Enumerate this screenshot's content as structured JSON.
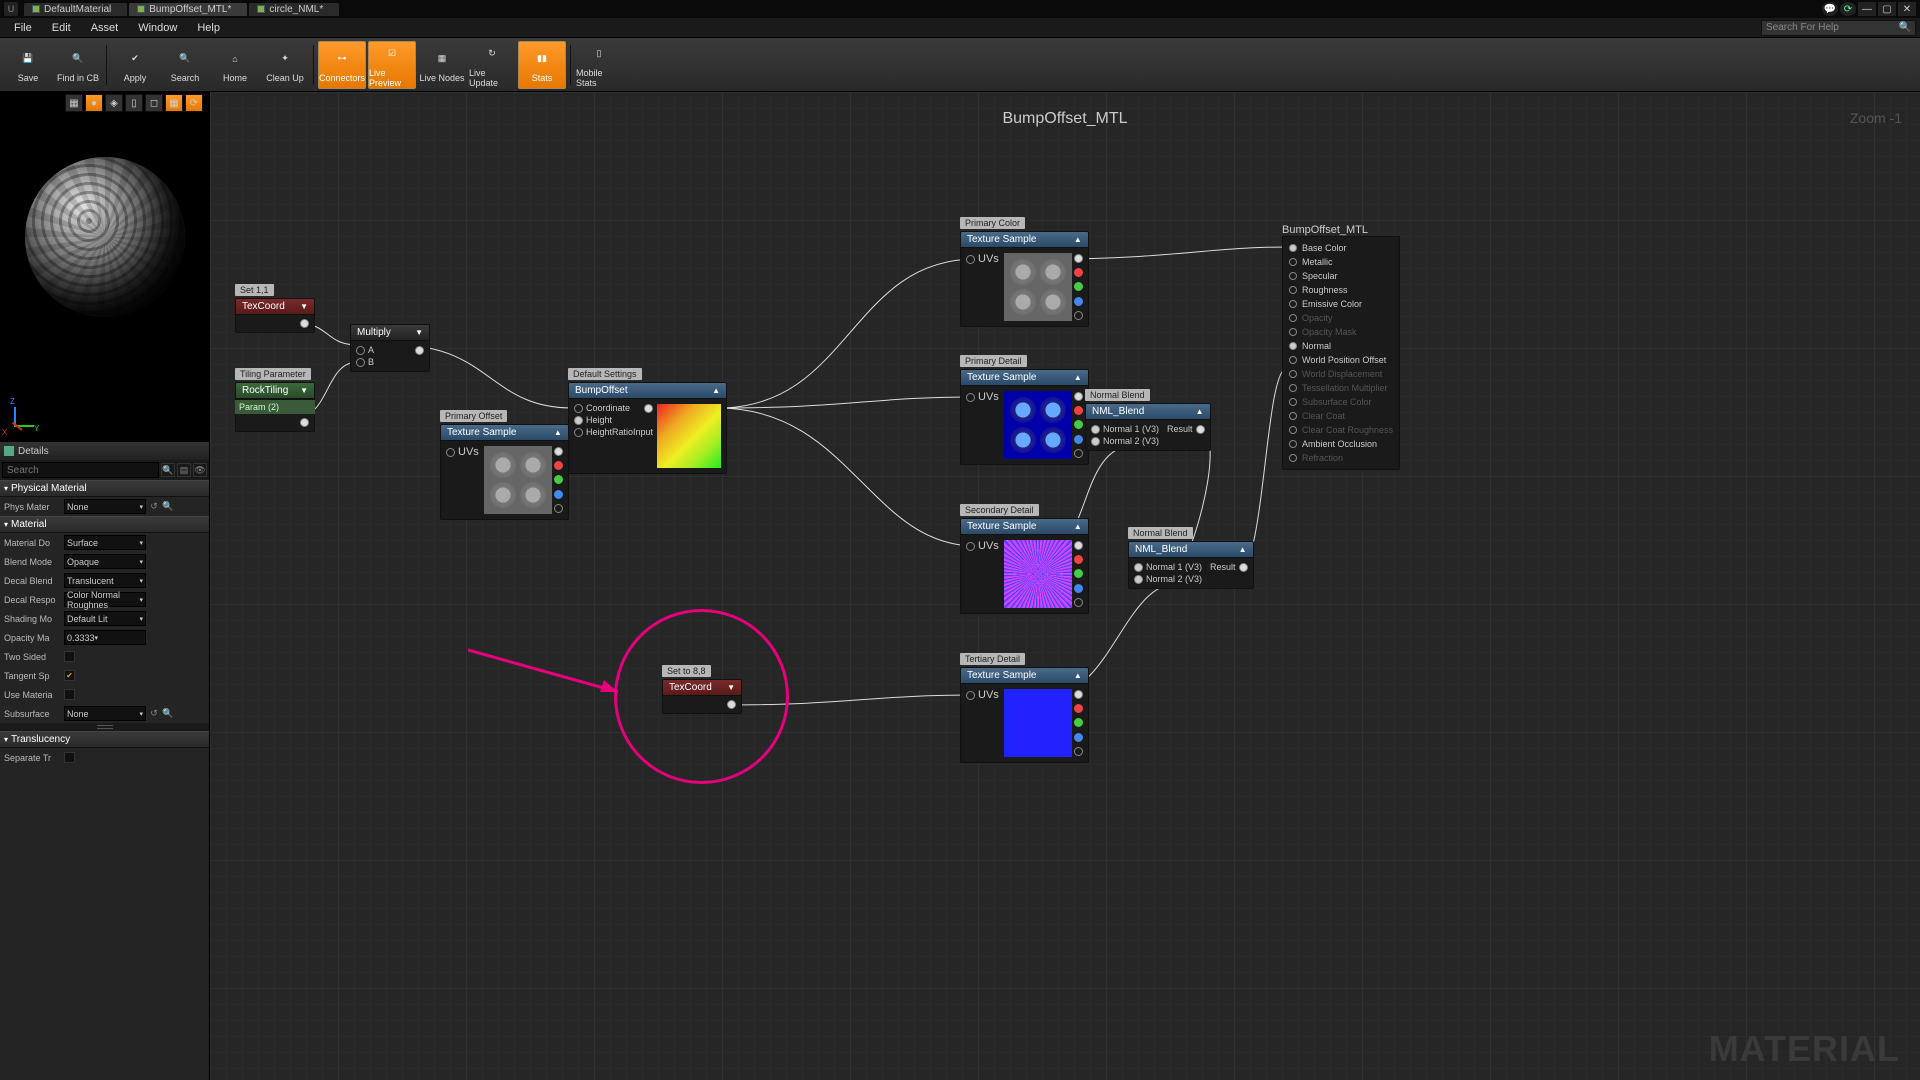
{
  "titlebar": {
    "tabs": [
      {
        "label": "DefaultMaterial",
        "active": false
      },
      {
        "label": "BumpOffset_MTL*",
        "active": true
      },
      {
        "label": "circle_NML*",
        "active": false
      }
    ]
  },
  "menu": {
    "items": [
      "File",
      "Edit",
      "Asset",
      "Window",
      "Help"
    ],
    "help_search_placeholder": "Search For Help"
  },
  "toolbar": [
    {
      "label": "Save",
      "active": false,
      "icon": "floppy-icon",
      "glyph": "💾"
    },
    {
      "label": "Find in CB",
      "active": false,
      "icon": "search-folder-icon",
      "glyph": "🔍"
    },
    {
      "label": "Apply",
      "active": false,
      "icon": "apply-icon",
      "glyph": "✔"
    },
    {
      "label": "Search",
      "active": false,
      "icon": "search-icon",
      "glyph": "🔍"
    },
    {
      "label": "Home",
      "active": false,
      "icon": "home-icon",
      "glyph": "⌂"
    },
    {
      "label": "Clean Up",
      "active": false,
      "icon": "cleanup-icon",
      "glyph": "✦"
    },
    {
      "label": "Connectors",
      "active": true,
      "icon": "connectors-icon",
      "glyph": "⊶"
    },
    {
      "label": "Live Preview",
      "active": true,
      "icon": "live-preview-icon",
      "glyph": "☑"
    },
    {
      "label": "Live Nodes",
      "active": false,
      "icon": "live-nodes-icon",
      "glyph": "▦"
    },
    {
      "label": "Live Update",
      "active": false,
      "icon": "live-update-icon",
      "glyph": "↻"
    },
    {
      "label": "Stats",
      "active": true,
      "icon": "stats-icon",
      "glyph": "▮▮"
    },
    {
      "label": "Mobile Stats",
      "active": false,
      "icon": "mobile-stats-icon",
      "glyph": "▯"
    }
  ],
  "preview": {
    "toolbar_count": 7,
    "axis": {
      "x": "X",
      "y": "Y",
      "z": "Z"
    }
  },
  "details": {
    "title": "Details",
    "search_placeholder": "Search",
    "sections": [
      {
        "title": "Physical Material",
        "rows": [
          {
            "label": "Phys Mater",
            "type": "combo",
            "value": "None",
            "extra": "reset+browse"
          }
        ]
      },
      {
        "title": "Material",
        "rows": [
          {
            "label": "Material Do",
            "type": "combo",
            "value": "Surface"
          },
          {
            "label": "Blend Mode",
            "type": "combo",
            "value": "Opaque"
          },
          {
            "label": "Decal Blend",
            "type": "combo",
            "value": "Translucent"
          },
          {
            "label": "Decal Respo",
            "type": "combo",
            "value": "Color Normal Roughnes"
          },
          {
            "label": "Shading Mo",
            "type": "combo",
            "value": "Default Lit"
          },
          {
            "label": "Opacity Ma",
            "type": "text",
            "value": "0.3333"
          },
          {
            "label": "Two Sided",
            "type": "check",
            "value": false
          },
          {
            "label": "Tangent Sp",
            "type": "check",
            "value": true
          },
          {
            "label": "Use Materia",
            "type": "check",
            "value": false
          },
          {
            "label": "Subsurface",
            "type": "combo",
            "value": "None",
            "extra": "reset+browse"
          }
        ]
      },
      {
        "title": "Translucency",
        "rows": [
          {
            "label": "Separate Tr",
            "type": "check",
            "value": false
          }
        ]
      }
    ]
  },
  "graph": {
    "title": "BumpOffset_MTL",
    "zoom": "Zoom  -1",
    "watermark": "MATERIAL",
    "comments": {
      "set11": "Set 1,1",
      "tiling": "Tiling Parameter",
      "primary_offset": "Primary Offset",
      "default": "Default Settings",
      "set88": "Set to 8,8",
      "pcolor": "Primary Color",
      "pdetail": "Primary Detail",
      "sdetail": "Secondary Detail",
      "tdetail": "Tertiary Detail",
      "nb1": "Normal Blend",
      "nb2": "Normal Blend"
    },
    "nodes": {
      "texcoord1": "TexCoord",
      "texcoord2": "TexCoord",
      "rocktiling": "RockTiling",
      "rockparam": "Param (2)",
      "multiply": "Multiply",
      "texsample": "Texture Sample",
      "bumpoffset": "BumpOffset",
      "nmlblend": "NML_Blend",
      "bo_coord": "Coordinate",
      "bo_height": "Height",
      "bo_hri": "HeightRatioInput",
      "mul_a": "A",
      "mul_b": "B",
      "ts_uvs": "UVs",
      "nb_n1": "Normal 1 (V3)",
      "nb_n2": "Normal 2 (V3)",
      "nb_res": "Result"
    },
    "output": {
      "title": "BumpOffset_MTL",
      "pins": [
        {
          "label": "Base Color",
          "on": true
        },
        {
          "label": "Metallic",
          "on": false
        },
        {
          "label": "Specular",
          "on": false
        },
        {
          "label": "Roughness",
          "on": false
        },
        {
          "label": "Emissive Color",
          "on": false
        },
        {
          "label": "Opacity",
          "on": false,
          "dim": true
        },
        {
          "label": "Opacity Mask",
          "on": false,
          "dim": true
        },
        {
          "label": "Normal",
          "on": true
        },
        {
          "label": "World Position Offset",
          "on": false
        },
        {
          "label": "World Displacement",
          "on": false,
          "dim": true
        },
        {
          "label": "Tessellation Multiplier",
          "on": false,
          "dim": true
        },
        {
          "label": "Subsurface Color",
          "on": false,
          "dim": true
        },
        {
          "label": "Clear Coat",
          "on": false,
          "dim": true
        },
        {
          "label": "Clear Coat Roughness",
          "on": false,
          "dim": true
        },
        {
          "label": "Ambient Occlusion",
          "on": false
        },
        {
          "label": "Refraction",
          "on": false,
          "dim": true
        }
      ]
    }
  }
}
